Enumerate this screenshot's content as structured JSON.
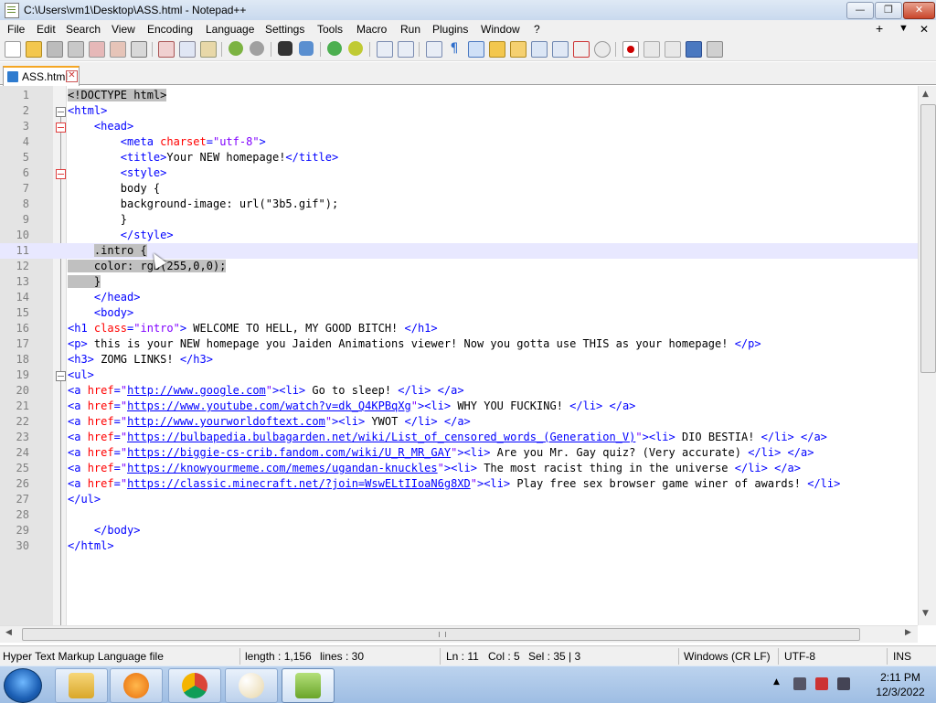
{
  "window": {
    "title": "C:\\Users\\vm1\\Desktop\\ASS.html - Notepad++",
    "controls": {
      "minimize": "—",
      "maximize": "❐",
      "close": "✕"
    }
  },
  "menu": {
    "items": [
      "File",
      "Edit",
      "Search",
      "View",
      "Encoding",
      "Language",
      "Settings",
      "Tools",
      "Macro",
      "Run",
      "Plugins",
      "Window",
      "?"
    ],
    "right": [
      "+",
      "▼",
      "✕"
    ]
  },
  "toolbar": {
    "icons": [
      "new-file-icon",
      "open-file-icon",
      "save-icon",
      "save-all-icon",
      "close-icon",
      "close-all-icon",
      "print-icon",
      "cut-icon",
      "copy-icon",
      "paste-icon",
      "undo-icon",
      "redo-icon",
      "find-icon",
      "replace-icon",
      "zoom-in-icon",
      "zoom-out-icon",
      "sync-vertical-icon",
      "sync-horizontal-icon",
      "word-wrap-icon",
      "show-all-chars-icon",
      "indent-guide-icon",
      "folder-as-workspace-icon",
      "function-list-icon",
      "document-map-icon",
      "doc-list-icon",
      "user-define-icon",
      "monitoring-icon",
      "record-macro-icon",
      "stop-record-icon",
      "play-macro-icon",
      "run-macro-multiple-icon",
      "save-macro-icon"
    ]
  },
  "tab": {
    "label": "ASS.html"
  },
  "editor": {
    "lines": [
      {
        "n": "1",
        "parts": [
          [
            "t-sel",
            "<"
          ],
          [
            "t-sel",
            "!DOCTYPE html"
          ],
          [
            "t-sel",
            ">"
          ]
        ]
      },
      {
        "n": "2",
        "parts": [
          [
            "t-tag",
            "<html>"
          ]
        ]
      },
      {
        "n": "3",
        "parts": [
          [
            "",
            "    "
          ],
          [
            "t-tag",
            "<head>"
          ]
        ]
      },
      {
        "n": "4",
        "parts": [
          [
            "",
            "        "
          ],
          [
            "t-tag",
            "<meta "
          ],
          [
            "t-attr",
            "charset"
          ],
          [
            "t-tag",
            "="
          ],
          [
            "t-str",
            "\"utf-8\""
          ],
          [
            "t-tag",
            ">"
          ]
        ]
      },
      {
        "n": "5",
        "parts": [
          [
            "",
            "        "
          ],
          [
            "t-tag",
            "<title>"
          ],
          [
            "",
            "Your NEW homepage!"
          ],
          [
            "t-tag",
            "</title>"
          ]
        ]
      },
      {
        "n": "6",
        "parts": [
          [
            "",
            "        "
          ],
          [
            "t-tag",
            "<style>"
          ]
        ]
      },
      {
        "n": "7",
        "parts": [
          [
            "",
            "        body {"
          ]
        ]
      },
      {
        "n": "8",
        "parts": [
          [
            "",
            "        background-image: url(\"3b5.gif\");"
          ]
        ]
      },
      {
        "n": "9",
        "parts": [
          [
            "",
            "        }"
          ]
        ]
      },
      {
        "n": "10",
        "parts": [
          [
            "",
            "        "
          ],
          [
            "t-tag",
            "</style>"
          ]
        ]
      },
      {
        "n": "11",
        "parts": [
          [
            "",
            "    "
          ],
          [
            "t-sel",
            ".intro {"
          ]
        ]
      },
      {
        "n": "12",
        "parts": [
          [
            "t-sel",
            "    color: rgb(255,0,0);"
          ]
        ]
      },
      {
        "n": "13",
        "parts": [
          [
            "t-sel",
            "    }"
          ]
        ]
      },
      {
        "n": "14",
        "parts": [
          [
            "",
            "    "
          ],
          [
            "t-tag",
            "</head>"
          ]
        ]
      },
      {
        "n": "15",
        "parts": [
          [
            "",
            "    "
          ],
          [
            "t-tag",
            "<body>"
          ]
        ]
      },
      {
        "n": "16",
        "parts": [
          [
            "t-tag",
            "<h1 "
          ],
          [
            "t-attr",
            "class"
          ],
          [
            "t-tag",
            "="
          ],
          [
            "t-str",
            "\"intro\""
          ],
          [
            "t-tag",
            ">"
          ],
          [
            "",
            " WELCOME TO HELL, MY GOOD BITCH! "
          ],
          [
            "t-tag",
            "</h1>"
          ]
        ]
      },
      {
        "n": "17",
        "parts": [
          [
            "t-tag",
            "<p>"
          ],
          [
            "",
            " this is your NEW homepage you Jaiden Animations viewer! Now you gotta use THIS as your homepage! "
          ],
          [
            "t-tag",
            "</p>"
          ]
        ]
      },
      {
        "n": "18",
        "parts": [
          [
            "t-tag",
            "<h3>"
          ],
          [
            "",
            " ZOMG LINKS! "
          ],
          [
            "t-tag",
            "</h3>"
          ]
        ]
      },
      {
        "n": "19",
        "parts": [
          [
            "t-tag",
            "<ul>"
          ]
        ]
      },
      {
        "n": "20",
        "parts": [
          [
            "t-tag",
            "<a "
          ],
          [
            "t-attr",
            "href"
          ],
          [
            "t-tag",
            "="
          ],
          [
            "t-str",
            "\""
          ],
          [
            "t-url",
            "http://www.google.com"
          ],
          [
            "t-str",
            "\""
          ],
          [
            "t-tag",
            "><li>"
          ],
          [
            "",
            " Go to sleep! "
          ],
          [
            "t-tag",
            "</li> </a>"
          ]
        ]
      },
      {
        "n": "21",
        "parts": [
          [
            "t-tag",
            "<a "
          ],
          [
            "t-attr",
            "href"
          ],
          [
            "t-tag",
            "="
          ],
          [
            "t-str",
            "\""
          ],
          [
            "t-url",
            "https://www.youtube.com/watch?v=dk_Q4KPBqXg"
          ],
          [
            "t-str",
            "\""
          ],
          [
            "t-tag",
            "><li>"
          ],
          [
            "",
            " WHY YOU FUCKING! "
          ],
          [
            "t-tag",
            "</li> </a>"
          ]
        ]
      },
      {
        "n": "22",
        "parts": [
          [
            "t-tag",
            "<a "
          ],
          [
            "t-attr",
            "href"
          ],
          [
            "t-tag",
            "="
          ],
          [
            "t-str",
            "\""
          ],
          [
            "t-url",
            "http://www.yourworldoftext.com"
          ],
          [
            "t-str",
            "\""
          ],
          [
            "t-tag",
            "><li>"
          ],
          [
            "",
            " YWOT "
          ],
          [
            "t-tag",
            "</li> </a>"
          ]
        ]
      },
      {
        "n": "23",
        "parts": [
          [
            "t-tag",
            "<a "
          ],
          [
            "t-attr",
            "href"
          ],
          [
            "t-tag",
            "="
          ],
          [
            "t-str",
            "\""
          ],
          [
            "t-url",
            "https://bulbapedia.bulbagarden.net/wiki/List_of_censored_words_(Generation_V)"
          ],
          [
            "t-str",
            "\""
          ],
          [
            "t-tag",
            "><li>"
          ],
          [
            "",
            " DIO BESTIA! "
          ],
          [
            "t-tag",
            "</li> </a>"
          ]
        ]
      },
      {
        "n": "24",
        "parts": [
          [
            "t-tag",
            "<a "
          ],
          [
            "t-attr",
            "href"
          ],
          [
            "t-tag",
            "="
          ],
          [
            "t-str",
            "\""
          ],
          [
            "t-url",
            "https://biggie-cs-crib.fandom.com/wiki/U_R_MR_GAY"
          ],
          [
            "t-str",
            "\""
          ],
          [
            "t-tag",
            "><li>"
          ],
          [
            "",
            " Are you Mr. Gay quiz? (Very accurate) "
          ],
          [
            "t-tag",
            "</li> </a>"
          ]
        ]
      },
      {
        "n": "25",
        "parts": [
          [
            "t-tag",
            "<a "
          ],
          [
            "t-attr",
            "href"
          ],
          [
            "t-tag",
            "="
          ],
          [
            "t-str",
            "\""
          ],
          [
            "t-url",
            "https://knowyourmeme.com/memes/ugandan-knuckles"
          ],
          [
            "t-str",
            "\""
          ],
          [
            "t-tag",
            "><li>"
          ],
          [
            "",
            " The most racist thing in the universe "
          ],
          [
            "t-tag",
            "</li> </a>"
          ]
        ]
      },
      {
        "n": "26",
        "parts": [
          [
            "t-tag",
            "<a "
          ],
          [
            "t-attr",
            "href"
          ],
          [
            "t-tag",
            "="
          ],
          [
            "t-str",
            "\""
          ],
          [
            "t-url",
            "https://classic.minecraft.net/?join=WswELtIIoaN6g8XD"
          ],
          [
            "t-str",
            "\""
          ],
          [
            "t-tag",
            "><li>"
          ],
          [
            "",
            " Play free sex browser game winer of awards! "
          ],
          [
            "t-tag",
            "</li>"
          ]
        ]
      },
      {
        "n": "27",
        "parts": [
          [
            "t-tag",
            "</ul>"
          ]
        ]
      },
      {
        "n": "28",
        "parts": []
      },
      {
        "n": "29",
        "parts": [
          [
            "",
            "    "
          ],
          [
            "t-tag",
            "</body>"
          ]
        ]
      },
      {
        "n": "30",
        "parts": [
          [
            "t-tag",
            "</html>"
          ]
        ]
      }
    ],
    "current_line": "11"
  },
  "statusbar": {
    "file_type": "Hyper Text Markup Language file",
    "length": "length : 1,156",
    "lines": "lines : 30",
    "ln": "Ln : 11",
    "col": "Col : 5",
    "sel": "Sel : 35 | 3",
    "eol": "Windows (CR LF)",
    "encoding": "UTF-8",
    "mode": "INS"
  },
  "taskbar": {
    "apps": [
      "explorer-icon",
      "media-player-icon",
      "chrome-icon",
      "paint-icon",
      "notepadpp-icon"
    ],
    "time": "2:11 PM",
    "date": "12/3/2022"
  },
  "colors": {
    "tag": "#0000ff",
    "attr": "#ff0000",
    "string": "#8000ff",
    "selection": "#c0c0c0"
  }
}
